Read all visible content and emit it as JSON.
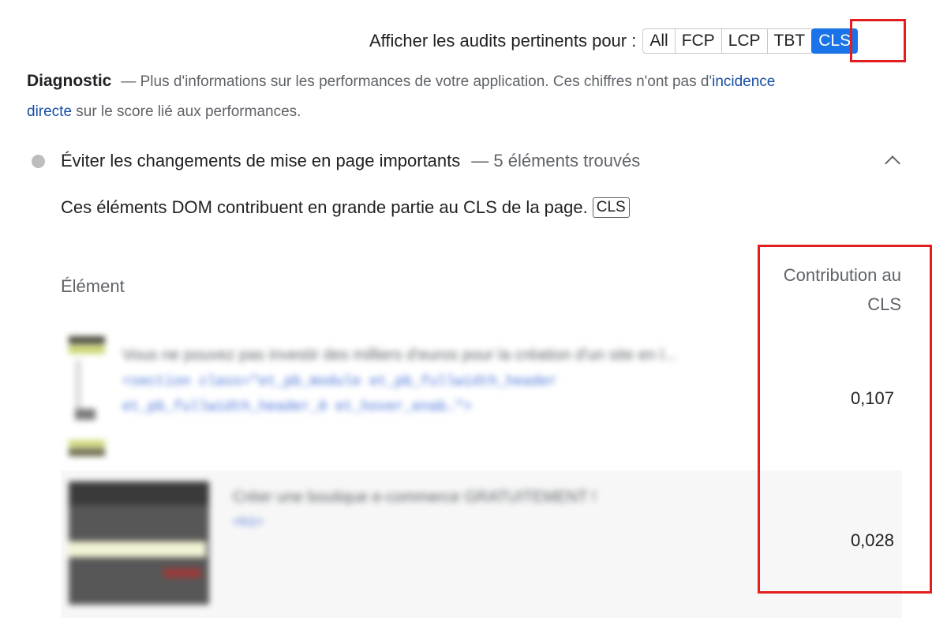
{
  "filter": {
    "label": "Afficher les audits pertinents pour :",
    "options": [
      "All",
      "FCP",
      "LCP",
      "TBT",
      "CLS"
    ],
    "active": "CLS"
  },
  "diagnostic": {
    "title": "Diagnostic",
    "text_before": "— Plus d'informations sur les performances de votre application. Ces chiffres n'ont pas d'",
    "link": "incidence directe",
    "text_after": " sur le score lié aux performances."
  },
  "audit": {
    "title": "Éviter les changements de mise en page importants",
    "count": "— 5 éléments trouvés",
    "description": "Ces éléments DOM contribuent en grande partie au CLS de la page.",
    "tag": "CLS"
  },
  "table": {
    "col_element": "Élément",
    "col_contribution": "Contribution au CLS",
    "rows": [
      {
        "snippet_text": "Vous ne pouvez pas investir des milliers d'euros pour la création d'un site en l...",
        "snippet_code": "<section class=\"et_pb_module et_pb_fullwidth_header et_pb_fullwidth_header_0 et_hover_enab…\">",
        "value": "0,107"
      },
      {
        "snippet_text": "Créer une boutique e-commerce GRATUITEMENT !",
        "snippet_code": "<h1>",
        "value": "0,028"
      }
    ]
  },
  "colors": {
    "accent": "#1a73e8",
    "highlight": "#e41e1e",
    "link": "#174ea6"
  }
}
